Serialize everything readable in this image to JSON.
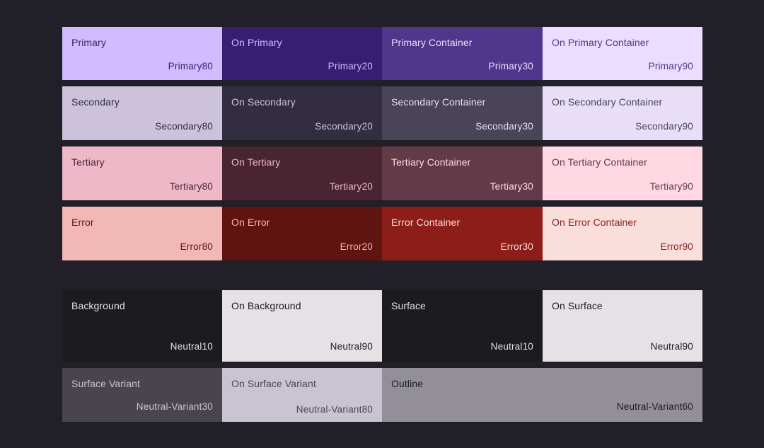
{
  "palette_groups": [
    {
      "rows": [
        {
          "cells": [
            {
              "name": "Primary",
              "tone": "Primary80",
              "bg": "#d0bcff",
              "fg": "#381e72"
            },
            {
              "name": "On Primary",
              "tone": "Primary20",
              "bg": "#381e72",
              "fg": "#d0bcff"
            },
            {
              "name": "Primary Container",
              "tone": "Primary30",
              "bg": "#4f378b",
              "fg": "#eaddff"
            },
            {
              "name": "On Primary Container",
              "tone": "Primary90",
              "bg": "#eaddff",
              "fg": "#4f378b"
            }
          ]
        },
        {
          "cells": [
            {
              "name": "Secondary",
              "tone": "Secondary80",
              "bg": "#ccc2dc",
              "fg": "#332d41"
            },
            {
              "name": "On Secondary",
              "tone": "Secondary20",
              "bg": "#332d41",
              "fg": "#ccc2dc"
            },
            {
              "name": "Secondary Container",
              "tone": "Secondary30",
              "bg": "#4a4458",
              "fg": "#e8def8"
            },
            {
              "name": "On Secondary Container",
              "tone": "Secondary90",
              "bg": "#e8def8",
              "fg": "#4a4458"
            }
          ]
        },
        {
          "cells": [
            {
              "name": "Tertiary",
              "tone": "Tertiary80",
              "bg": "#efb8c8",
              "fg": "#492532"
            },
            {
              "name": "On Tertiary",
              "tone": "Tertiary20",
              "bg": "#492532",
              "fg": "#efb8c8"
            },
            {
              "name": "Tertiary Container",
              "tone": "Tertiary30",
              "bg": "#633b48",
              "fg": "#ffd8e4"
            },
            {
              "name": "On Tertiary Container",
              "tone": "Tertiary90",
              "bg": "#ffd8e4",
              "fg": "#633b48"
            }
          ]
        },
        {
          "cells": [
            {
              "name": "Error",
              "tone": "Error80",
              "bg": "#f2b8b5",
              "fg": "#601410"
            },
            {
              "name": "On Error",
              "tone": "Error20",
              "bg": "#601410",
              "fg": "#f2b8b5"
            },
            {
              "name": "Error Container",
              "tone": "Error30",
              "bg": "#8c1d18",
              "fg": "#f9dedc"
            },
            {
              "name": "On Error Container",
              "tone": "Error90",
              "bg": "#f9dedc",
              "fg": "#8c1d18"
            }
          ]
        }
      ]
    },
    {
      "rows": [
        {
          "cells": [
            {
              "name": "Background",
              "tone": "Neutral10",
              "bg": "#1c1b1f",
              "fg": "#e6e1e5"
            },
            {
              "name": "On Background",
              "tone": "Neutral90",
              "bg": "#e6e1e5",
              "fg": "#1c1b1f"
            },
            {
              "name": "Surface",
              "tone": "Neutral10",
              "bg": "#1c1b1f",
              "fg": "#e6e1e5"
            },
            {
              "name": "On Surface",
              "tone": "Neutral90",
              "bg": "#e6e1e5",
              "fg": "#1c1b1f"
            }
          ]
        },
        {
          "cells": [
            {
              "name": "Surface Variant",
              "tone": "Neutral-Variant30",
              "bg": "#49454f",
              "fg": "#cac4d0"
            },
            {
              "name": "On Surface Variant",
              "tone": "Neutral-Variant80",
              "bg": "#cac4d0",
              "fg": "#49454f"
            },
            {
              "name": "Outline",
              "tone": "Neutral-Variant60",
              "bg": "#938f99",
              "fg": "#1c1b1f"
            }
          ]
        }
      ]
    }
  ]
}
